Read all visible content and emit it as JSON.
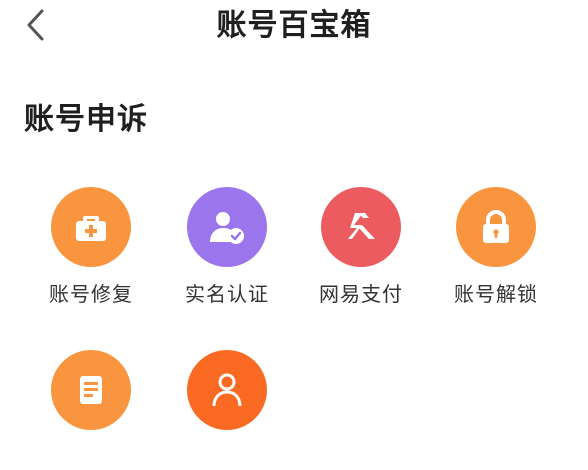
{
  "header": {
    "title": "账号百宝箱",
    "back_icon": "chevron-left-icon"
  },
  "section": {
    "title": "账号申诉"
  },
  "colors": {
    "orange": "#F9953F",
    "purple": "#9B75EC",
    "red": "#EC5B5F",
    "deep_orange": "#FA6A22"
  },
  "items": [
    {
      "label": "账号修复",
      "icon": "medical-kit-icon",
      "color": "#F9953F"
    },
    {
      "label": "实名认证",
      "icon": "user-verified-icon",
      "color": "#9B75EC"
    },
    {
      "label": "网易支付",
      "icon": "netease-pay-icon",
      "color": "#EC5B5F"
    },
    {
      "label": "账号解锁",
      "icon": "lock-icon",
      "color": "#F9953F"
    },
    {
      "label": "",
      "icon": "document-icon",
      "color": "#F9953F"
    },
    {
      "label": "",
      "icon": "customer-service-icon",
      "color": "#FA6A22"
    }
  ]
}
